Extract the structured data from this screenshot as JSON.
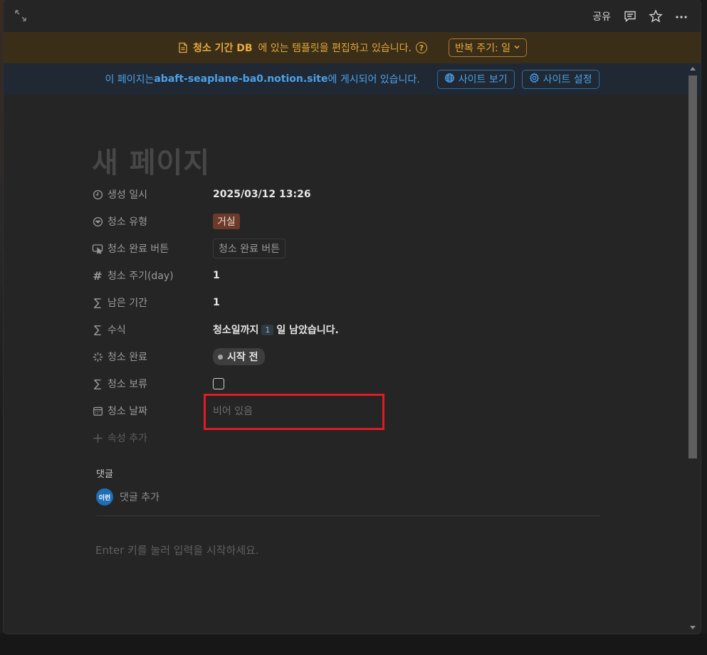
{
  "topbar": {
    "share_label": "공유",
    "icons": [
      "expand-icon",
      "comment-icon",
      "star-icon",
      "more-icon"
    ]
  },
  "template_banner": {
    "db_name": "청소 기간 DB",
    "message": "에 있는 템플릿을 편집하고 있습니다.",
    "help": "?",
    "repeat_label": "반복 주기: 일",
    "color": "#e2a73a"
  },
  "site_banner": {
    "prefix": "이 페이지는 ",
    "domain": "abaft-seaplane-ba0.notion.site",
    "suffix": "에 게시되어 있습니다.",
    "view_site": "사이트 보기",
    "site_settings": "사이트 설정",
    "color": "#4ea1e8"
  },
  "page": {
    "title": "새 페이지",
    "properties": [
      {
        "label": "생성 일시",
        "icon": "clock-icon",
        "value": "2025/03/12 13:26"
      },
      {
        "label": "청소 유형",
        "icon": "select-icon",
        "value": "거실"
      },
      {
        "label": "청소 완료 버튼",
        "icon": "button-icon",
        "value": "청소 완료 버튼"
      },
      {
        "label": "청소 주기(day)",
        "icon": "hash-icon",
        "value": "1"
      },
      {
        "label": "남은 기간",
        "icon": "sigma-icon",
        "value": "1"
      },
      {
        "label": "수식",
        "icon": "sigma-icon",
        "value_before": "청소일까지",
        "value_num": "1",
        "value_after": "일 남았습니다."
      },
      {
        "label": "청소 완료",
        "icon": "status-icon",
        "value": "시작 전"
      },
      {
        "label": "청소 보류",
        "icon": "sigma-icon",
        "value": "unchecked"
      },
      {
        "label": "청소 날짜",
        "icon": "calendar-icon",
        "value": "비어 있음"
      }
    ],
    "add_property": "속성 추가"
  },
  "comments": {
    "title": "댓글",
    "avatar_text": "이런",
    "add_label": "댓글 추가"
  },
  "body": {
    "placeholder": "Enter 키를 눌러 입력을 시작하세요."
  }
}
